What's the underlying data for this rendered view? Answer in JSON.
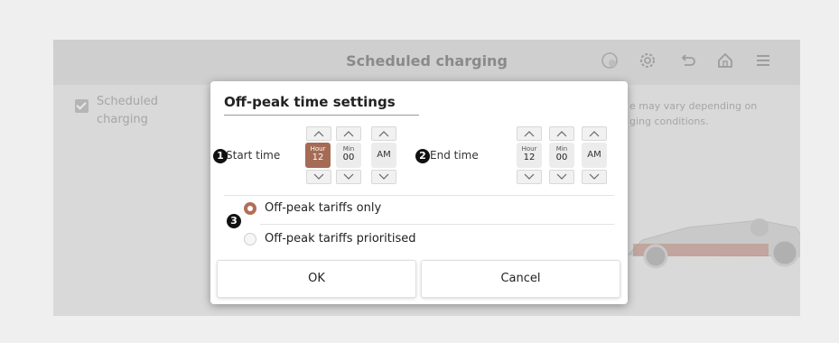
{
  "screen": {
    "title": "Scheduled charging",
    "background_option": {
      "label_line1": "Scheduled",
      "label_line2": "charging",
      "checked": true
    },
    "background_note": {
      "line1": "e may vary depending on",
      "line2": "ging conditions."
    }
  },
  "header_icons": [
    "globe-icon",
    "gear-icon",
    "back-icon",
    "home-icon",
    "menu-icon"
  ],
  "dialog": {
    "title": "Off-peak time settings",
    "start": {
      "badge": "1",
      "label": "Start time",
      "hour_caption": "Hour",
      "hour_value": "12",
      "min_caption": "Min",
      "min_value": "00",
      "ampm": "AM"
    },
    "end": {
      "badge": "2",
      "label": "End time",
      "hour_caption": "Hour",
      "hour_value": "12",
      "min_caption": "Min",
      "min_value": "00",
      "ampm": "AM"
    },
    "options_badge": "3",
    "options": [
      {
        "label": "Off-peak tariffs only",
        "selected": true
      },
      {
        "label": "Off-peak tariffs prioritised",
        "selected": false
      }
    ],
    "ok_label": "OK",
    "cancel_label": "Cancel"
  },
  "colors": {
    "accent": "#b36e57",
    "selected_box": "#a56b55"
  }
}
